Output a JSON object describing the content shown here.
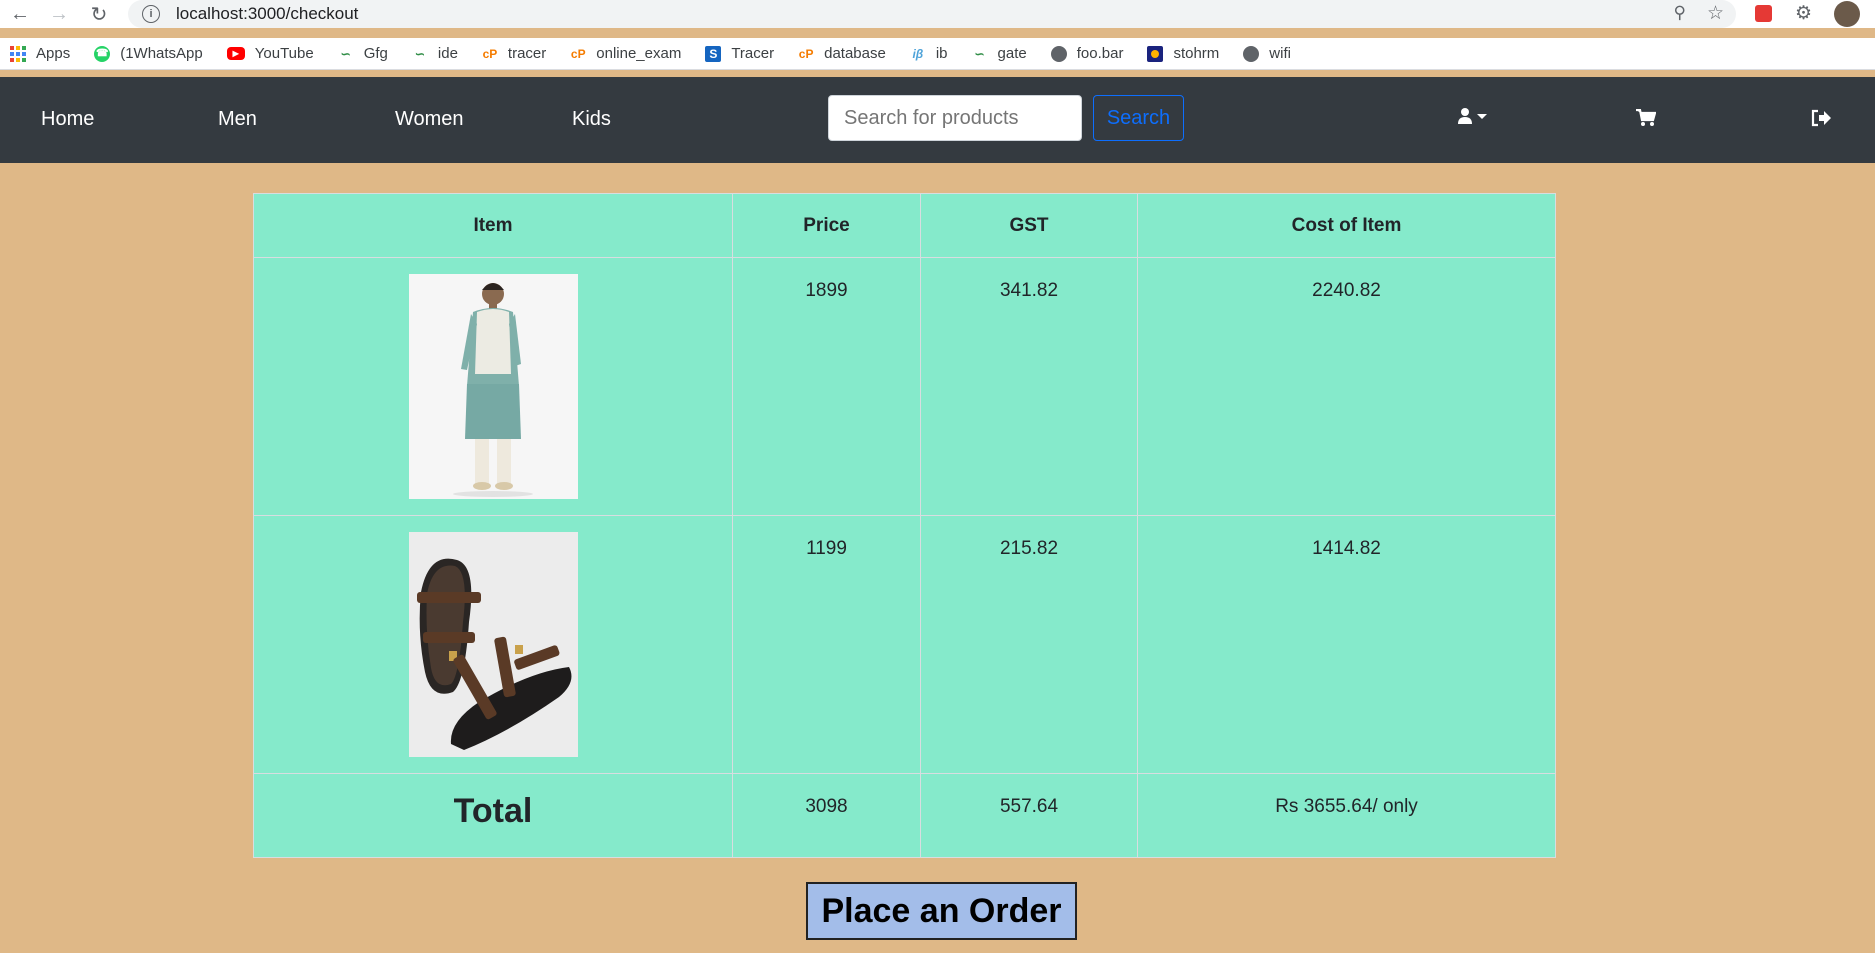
{
  "browser": {
    "url": "localhost:3000/checkout",
    "bookmarks": [
      {
        "label": "Apps",
        "icon": "apps-grid-icon"
      },
      {
        "label": "(1WhatsApp",
        "icon": "whatsapp-icon"
      },
      {
        "label": "YouTube",
        "icon": "youtube-icon"
      },
      {
        "label": "Gfg",
        "icon": "gfg-icon"
      },
      {
        "label": "ide",
        "icon": "gfg-icon"
      },
      {
        "label": "tracer",
        "icon": "codepen-icon"
      },
      {
        "label": "online_exam",
        "icon": "codepen-icon"
      },
      {
        "label": "Tracer",
        "icon": "s-icon"
      },
      {
        "label": "database",
        "icon": "codepen-icon"
      },
      {
        "label": "ib",
        "icon": "ib-icon"
      },
      {
        "label": "gate",
        "icon": "gfg-icon"
      },
      {
        "label": "foo.bar",
        "icon": "globe-icon"
      },
      {
        "label": "stohrm",
        "icon": "stohrm-icon"
      },
      {
        "label": "wifi",
        "icon": "globe-icon"
      }
    ]
  },
  "navbar": {
    "links": [
      "Home",
      "Men",
      "Women",
      "Kids"
    ],
    "search_placeholder": "Search for products",
    "search_button": "Search"
  },
  "table": {
    "headers": [
      "Item",
      "Price",
      "GST",
      "Cost of Item"
    ],
    "rows": [
      {
        "image": "kurta-jacket-product-image",
        "price": "1899",
        "gst": "341.82",
        "cost": "2240.82"
      },
      {
        "image": "sandals-product-image",
        "price": "1199",
        "gst": "215.82",
        "cost": "1414.82"
      }
    ],
    "total": {
      "label": "Total",
      "price": "3098",
      "gst": "557.64",
      "cost": "Rs 3655.64/ only"
    }
  },
  "order_button": "Place an Order",
  "colors": {
    "page_bg": "#dfb887",
    "table_bg": "#85eacb",
    "navbar_bg": "#343a40",
    "accent": "#0d6efd",
    "order_btn": "#a3bde9"
  }
}
